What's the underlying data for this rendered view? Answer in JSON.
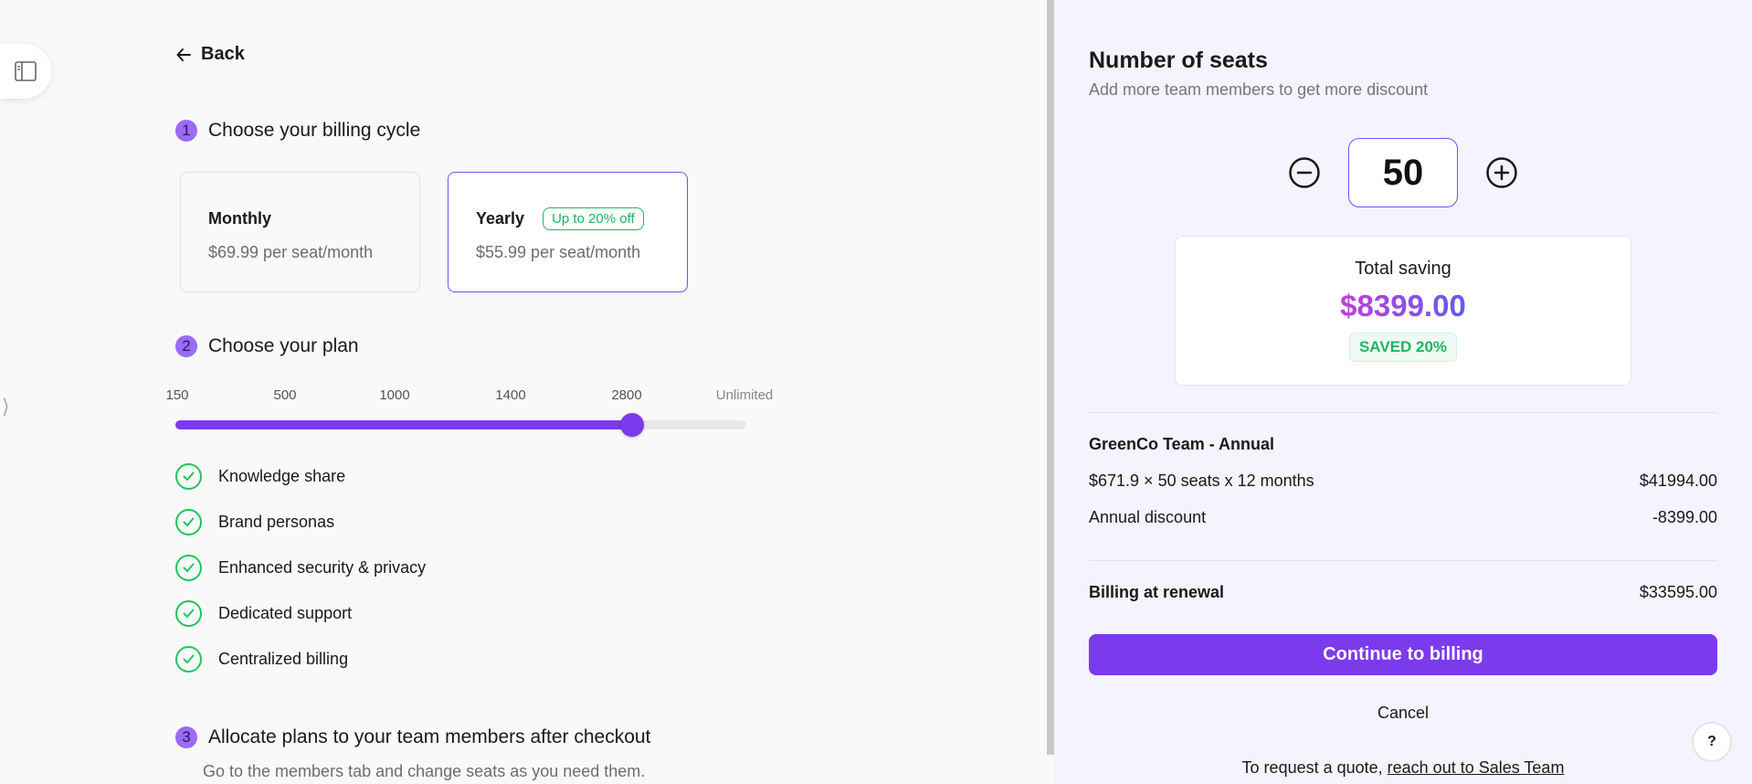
{
  "nav": {
    "back_label": "Back",
    "sidebar_toggle_icon": "sidebar-toggle-icon"
  },
  "steps": [
    {
      "number": "1",
      "title": "Choose your billing cycle"
    },
    {
      "number": "2",
      "title": "Choose your plan"
    },
    {
      "number": "3",
      "title": "Allocate plans to your team members after checkout",
      "subtitle": "Go to the members tab and change seats as you need them."
    }
  ],
  "billing_cycles": [
    {
      "name": "Monthly",
      "price": "$69.99 per seat/month",
      "badge": "",
      "selected": false
    },
    {
      "name": "Yearly",
      "price": "$55.99 per seat/month",
      "badge": "Up to 20% off",
      "selected": true
    }
  ],
  "plan_slider": {
    "ticks": [
      "150",
      "500",
      "1000",
      "1400",
      "2800",
      "Unlimited"
    ],
    "value_fraction": 0.8
  },
  "features": [
    "Knowledge share",
    "Brand personas",
    "Enhanced security & privacy",
    "Dedicated support",
    "Centralized billing"
  ],
  "seats": {
    "title": "Number of seats",
    "subtitle": "Add more team members to get more discount",
    "value": "50",
    "decrement_icon": "minus-circle-icon",
    "increment_icon": "plus-circle-icon"
  },
  "saving": {
    "label": "Total saving",
    "amount": "$8399.00",
    "badge": "SAVED 20%"
  },
  "summary": {
    "plan_name": "GreenCo Team - Annual",
    "lines": [
      {
        "label": "$671.9 × 50 seats x 12 months",
        "value": "$41994.00"
      },
      {
        "label": "Annual discount",
        "value": "-8399.00"
      }
    ],
    "total": {
      "label": "Billing at renewal",
      "value": "$33595.00"
    }
  },
  "actions": {
    "continue_label": "Continue to billing",
    "cancel_label": "Cancel",
    "quote_prefix": "To request a quote, ",
    "quote_link": "reach out to Sales Team",
    "help_label": "?"
  },
  "colors": {
    "accent": "#7c3aed",
    "success": "#22c55e",
    "panel_bg": "#f5f3fd"
  }
}
